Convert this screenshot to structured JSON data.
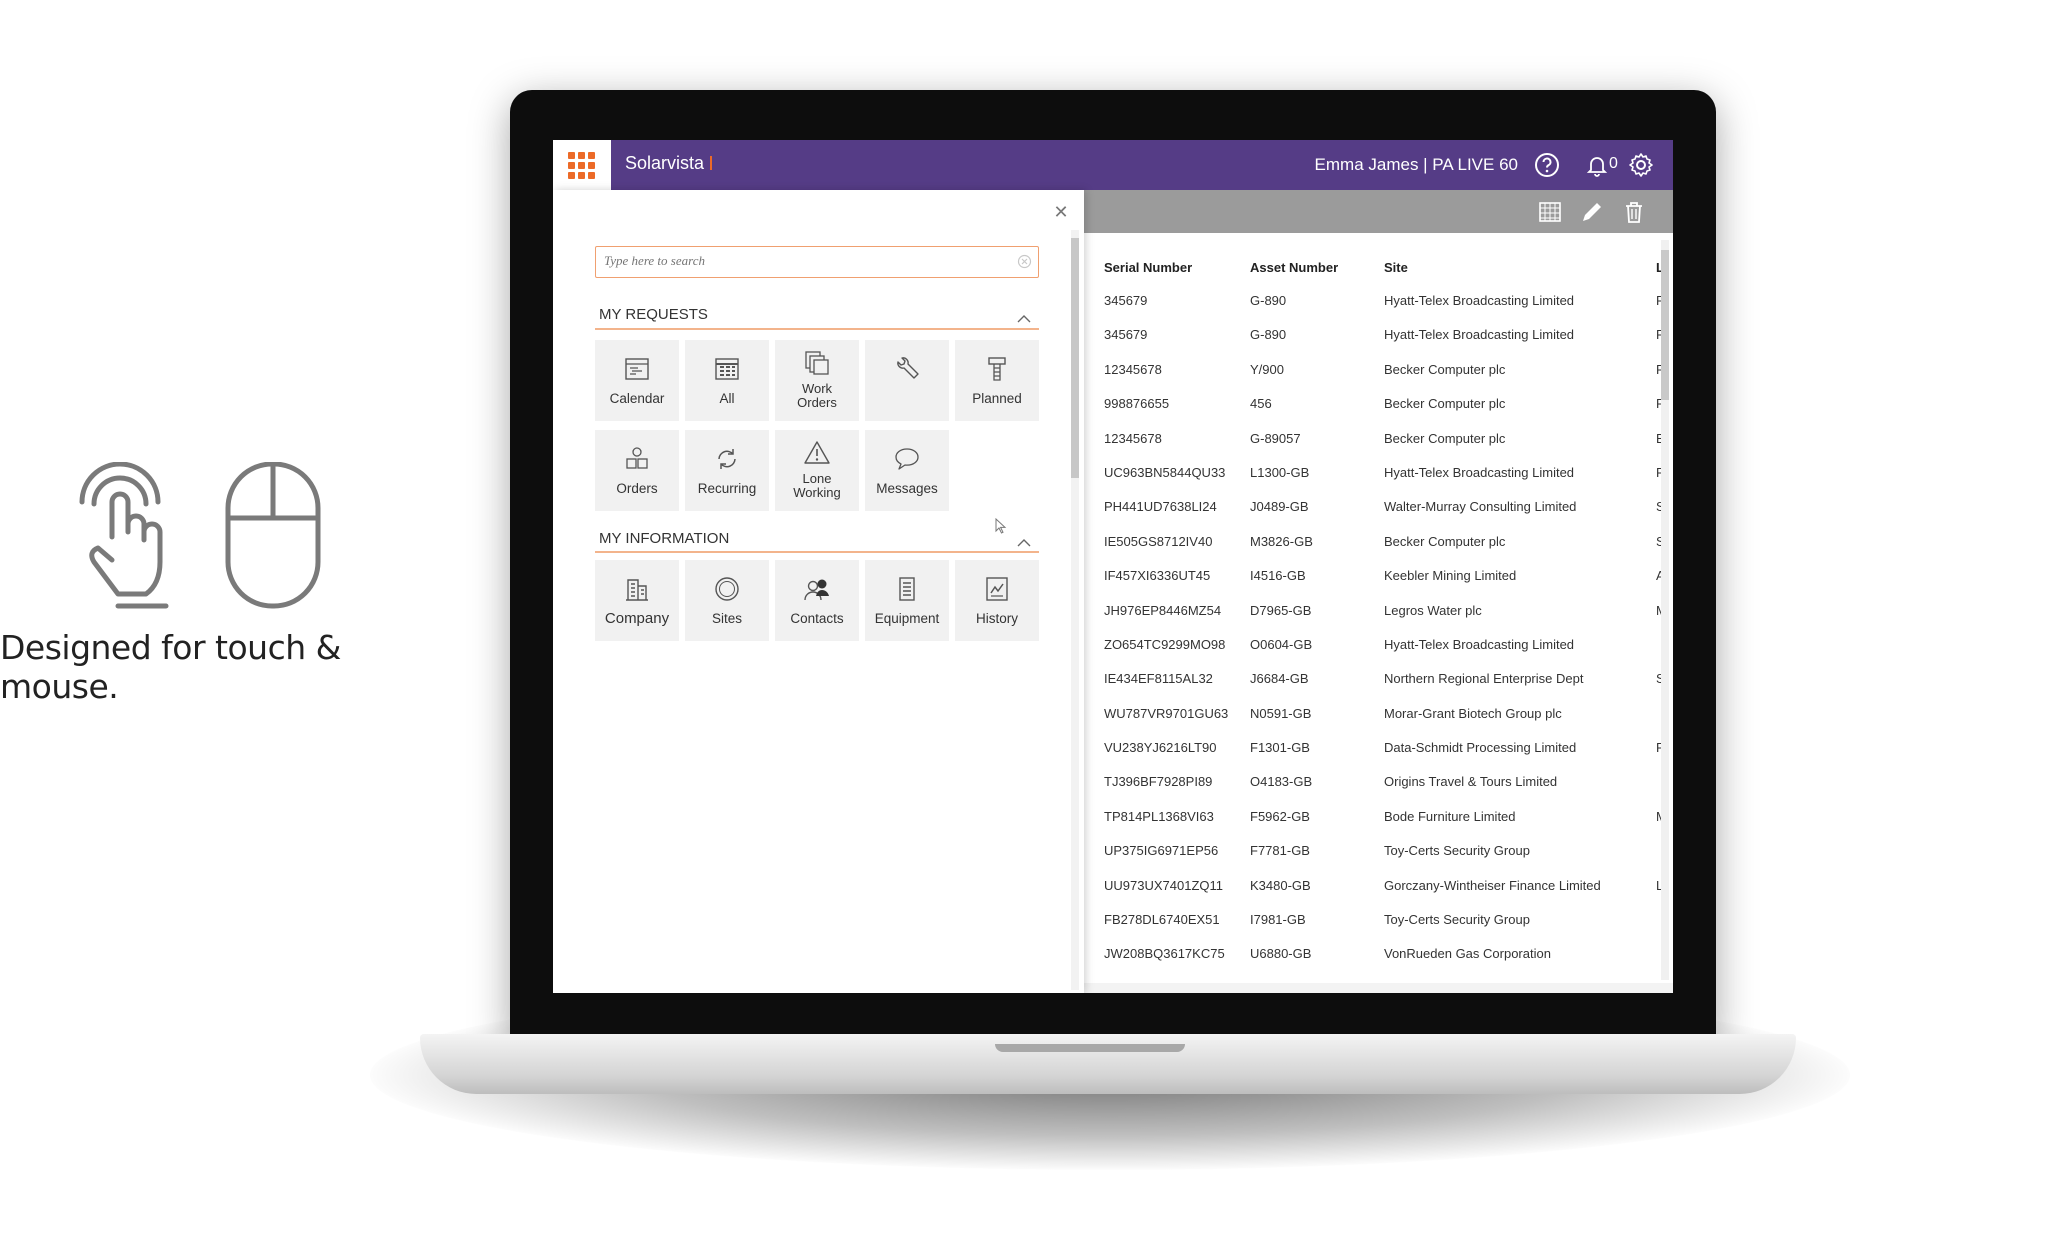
{
  "promo": {
    "caption": "Designed for touch & mouse.",
    "icons": [
      "touch-hand-icon",
      "mouse-icon"
    ]
  },
  "app": {
    "brand": "Solarvista",
    "user": "Emma James  |  PA LIVE 60",
    "notifications": "0",
    "colors": {
      "header": "#553c86",
      "accent": "#ec6a28",
      "toolbar": "#9b9b9b"
    }
  },
  "search": {
    "placeholder": "Type here to search"
  },
  "sections": {
    "requests": {
      "title": "MY REQUESTS",
      "tiles": [
        {
          "label": "Calendar",
          "icon": "calendar-icon"
        },
        {
          "label": "All",
          "icon": "grid-list-icon"
        },
        {
          "label": "Work Orders",
          "icon": "work-orders-icon"
        },
        {
          "label": "",
          "icon": "wrench-icon"
        },
        {
          "label": "Planned",
          "icon": "planned-tool-icon"
        },
        {
          "label": "Orders",
          "icon": "orders-icon"
        },
        {
          "label": "Recurring",
          "icon": "recurring-icon"
        },
        {
          "label": "Lone Working",
          "icon": "warning-triangle-icon"
        },
        {
          "label": "Messages",
          "icon": "speech-bubble-icon"
        }
      ]
    },
    "information": {
      "title": "MY INFORMATION",
      "tiles": [
        {
          "label": "Company",
          "icon": "company-building-icon"
        },
        {
          "label": "Sites",
          "icon": "sites-compass-icon"
        },
        {
          "label": "Contacts",
          "icon": "contacts-people-icon"
        },
        {
          "label": "Equipment",
          "icon": "equipment-icon"
        },
        {
          "label": "History",
          "icon": "history-icon"
        }
      ]
    }
  },
  "grid": {
    "toolbar_icons": [
      "grid-view-icon",
      "edit-pencil-icon",
      "trash-icon"
    ],
    "headers": [
      "Serial Number",
      "Asset Number",
      "Site",
      "L"
    ],
    "rows": [
      [
        "345679",
        "G-890",
        "Hyatt-Telex Broadcasting Limited",
        "R"
      ],
      [
        "345679",
        "G-890",
        "Hyatt-Telex Broadcasting Limited",
        "R"
      ],
      [
        "12345678",
        "Y/900",
        "Becker Computer plc",
        "R"
      ],
      [
        "998876655",
        "456",
        "Becker Computer plc",
        "F"
      ],
      [
        "12345678",
        "G-89057",
        "Becker Computer plc",
        "B"
      ],
      [
        "UC963BN5844QU33",
        "L1300-GB",
        "Hyatt-Telex Broadcasting Limited",
        "F"
      ],
      [
        "PH441UD7638LI24",
        "J0489-GB",
        "Walter-Murray Consulting Limited",
        "S"
      ],
      [
        "IE505GS8712IV40",
        "M3826-GB",
        "Becker Computer plc",
        "S"
      ],
      [
        "IF457XI6336UT45",
        "I4516-GB",
        "Keebler Mining Limited",
        "A"
      ],
      [
        "JH976EP8446MZ54",
        "D7965-GB",
        "Legros Water plc",
        "M"
      ],
      [
        "ZO654TC9299MO98",
        "O0604-GB",
        "Hyatt-Telex Broadcasting Limited",
        ""
      ],
      [
        "IE434EF8115AL32",
        "J6684-GB",
        "Northern Regional Enterprise Dept",
        "S"
      ],
      [
        "WU787VR9701GU63",
        "N0591-GB",
        "Morar-Grant Biotech Group plc",
        ""
      ],
      [
        "VU238YJ6216LT90",
        "F1301-GB",
        "Data-Schmidt Processing Limited",
        "F"
      ],
      [
        "TJ396BF7928PI89",
        "O4183-GB",
        "Origins Travel & Tours Limited",
        ""
      ],
      [
        "TP814PL1368VI63",
        "F5962-GB",
        "Bode Furniture Limited",
        "M"
      ],
      [
        "UP375IG6971EP56",
        "F7781-GB",
        "Toy-Certs Security Group",
        ""
      ],
      [
        "UU973UX7401ZQ11",
        "K3480-GB",
        "Gorczany-Wintheiser Finance Limited",
        "L"
      ],
      [
        "FB278DL6740EX51",
        "I7981-GB",
        "Toy-Certs Security Group",
        ""
      ],
      [
        "JW208BQ3617KC75",
        "U6880-GB",
        "VonRueden Gas Corporation",
        ""
      ]
    ]
  }
}
